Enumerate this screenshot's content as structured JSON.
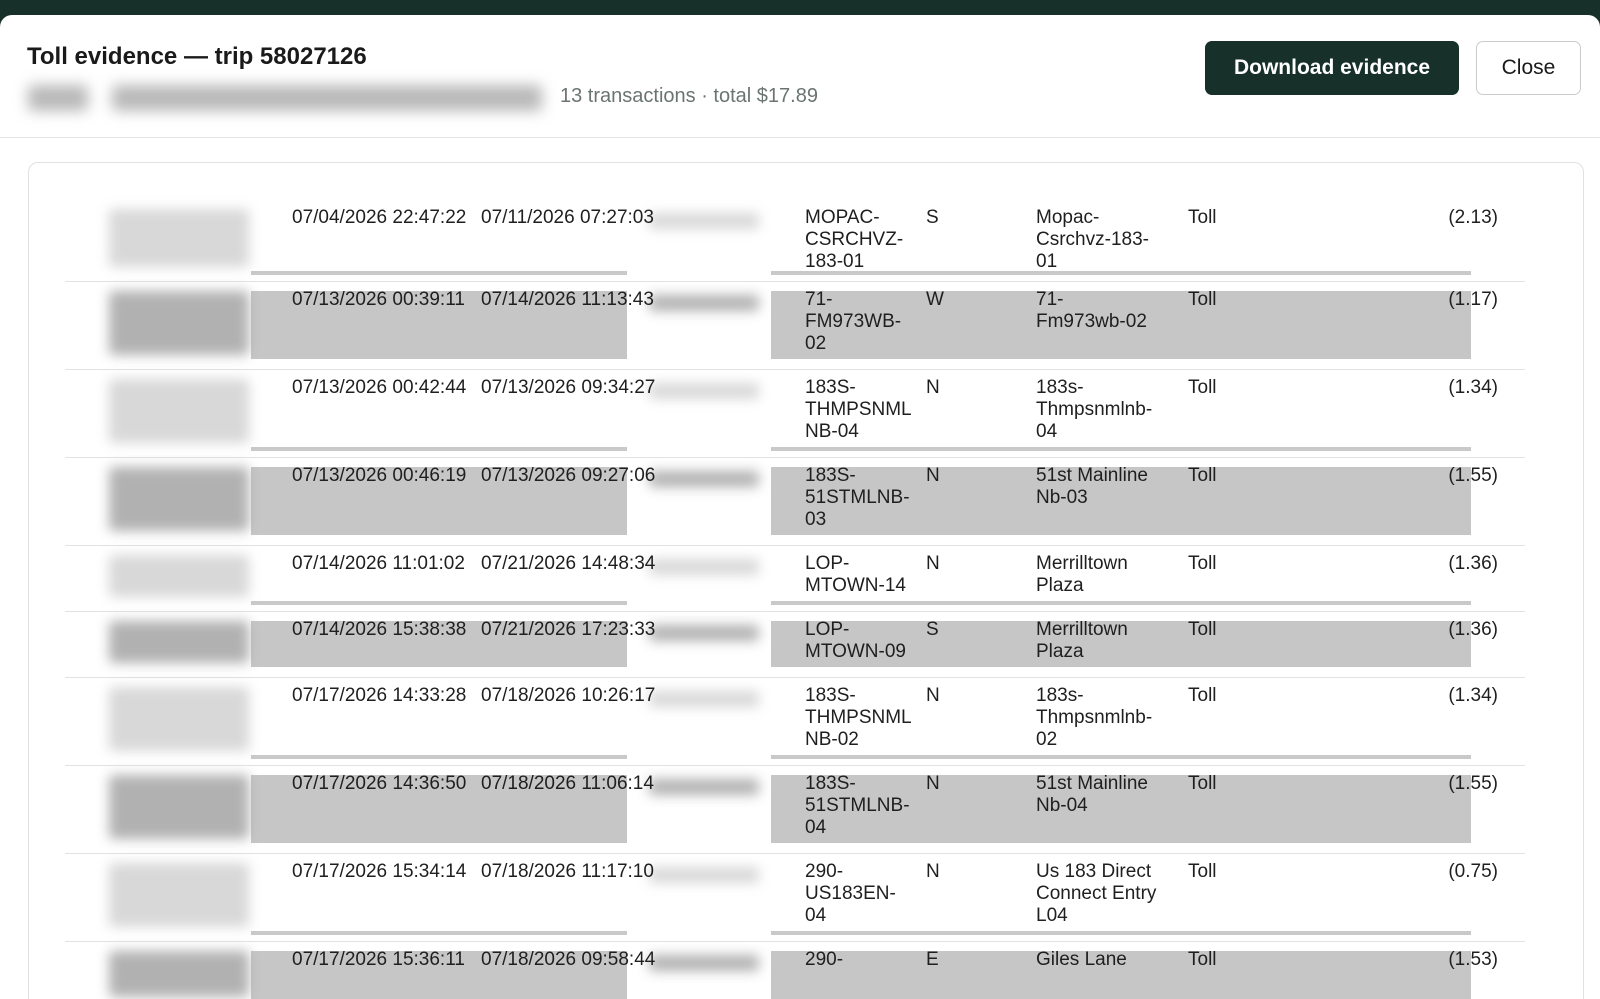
{
  "dialog": {
    "title": "Toll evidence — trip 58027126",
    "subtitle": "13 transactions · total $17.89",
    "download_label": "Download evidence",
    "close_label": "Close"
  },
  "table": {
    "rows": [
      {
        "entry": "07/04/2026 22:47:22",
        "posted": "07/11/2026 07:27:03",
        "plaza_code": "MOPAC-\nCSRCHVZ-\n183-01",
        "dir": "S",
        "location": "Mopac-\nCsrchvz-183-\n01",
        "type": "Toll",
        "amount": "(2.13)"
      },
      {
        "entry": "07/13/2026 00:39:11",
        "posted": "07/14/2026 11:13:43",
        "plaza_code": "71-\nFM973WB-\n02",
        "dir": "W",
        "location": "71-\nFm973wb-02",
        "type": "Toll",
        "amount": "(1.17)"
      },
      {
        "entry": "07/13/2026 00:42:44",
        "posted": "07/13/2026 09:34:27",
        "plaza_code": "183S-\nTHMPSNML\nNB-04",
        "dir": "N",
        "location": "183s-\nThmpsnmlnb-\n04",
        "type": "Toll",
        "amount": "(1.34)"
      },
      {
        "entry": "07/13/2026 00:46:19",
        "posted": "07/13/2026 09:27:06",
        "plaza_code": "183S-\n51STMLNB-\n03",
        "dir": "N",
        "location": "51st Mainline\nNb-03",
        "type": "Toll",
        "amount": "(1.55)"
      },
      {
        "entry": "07/14/2026 11:01:02",
        "posted": "07/21/2026 14:48:34",
        "plaza_code": "LOP-\nMTOWN-14",
        "dir": "N",
        "location": "Merrilltown\nPlaza",
        "type": "Toll",
        "amount": "(1.36)"
      },
      {
        "entry": "07/14/2026 15:38:38",
        "posted": "07/21/2026 17:23:33",
        "plaza_code": "LOP-\nMTOWN-09",
        "dir": "S",
        "location": "Merrilltown\nPlaza",
        "type": "Toll",
        "amount": "(1.36)"
      },
      {
        "entry": "07/17/2026 14:33:28",
        "posted": "07/18/2026 10:26:17",
        "plaza_code": "183S-\nTHMPSNML\nNB-02",
        "dir": "N",
        "location": "183s-\nThmpsnmlnb-\n02",
        "type": "Toll",
        "amount": "(1.34)"
      },
      {
        "entry": "07/17/2026 14:36:50",
        "posted": "07/18/2026 11:06:14",
        "plaza_code": "183S-\n51STMLNB-\n04",
        "dir": "N",
        "location": "51st Mainline\nNb-04",
        "type": "Toll",
        "amount": "(1.55)"
      },
      {
        "entry": "07/17/2026 15:34:14",
        "posted": "07/18/2026 11:17:10",
        "plaza_code": "290-\nUS183EN-\n04",
        "dir": "N",
        "location": "Us 183 Direct\nConnect Entry\nL04",
        "type": "Toll",
        "amount": "(0.75)"
      },
      {
        "entry": "07/17/2026 15:36:11",
        "posted": "07/18/2026 09:58:44",
        "plaza_code": "290-",
        "dir": "E",
        "location": "Giles Lane",
        "type": "Toll",
        "amount": "(1.53)"
      }
    ]
  }
}
